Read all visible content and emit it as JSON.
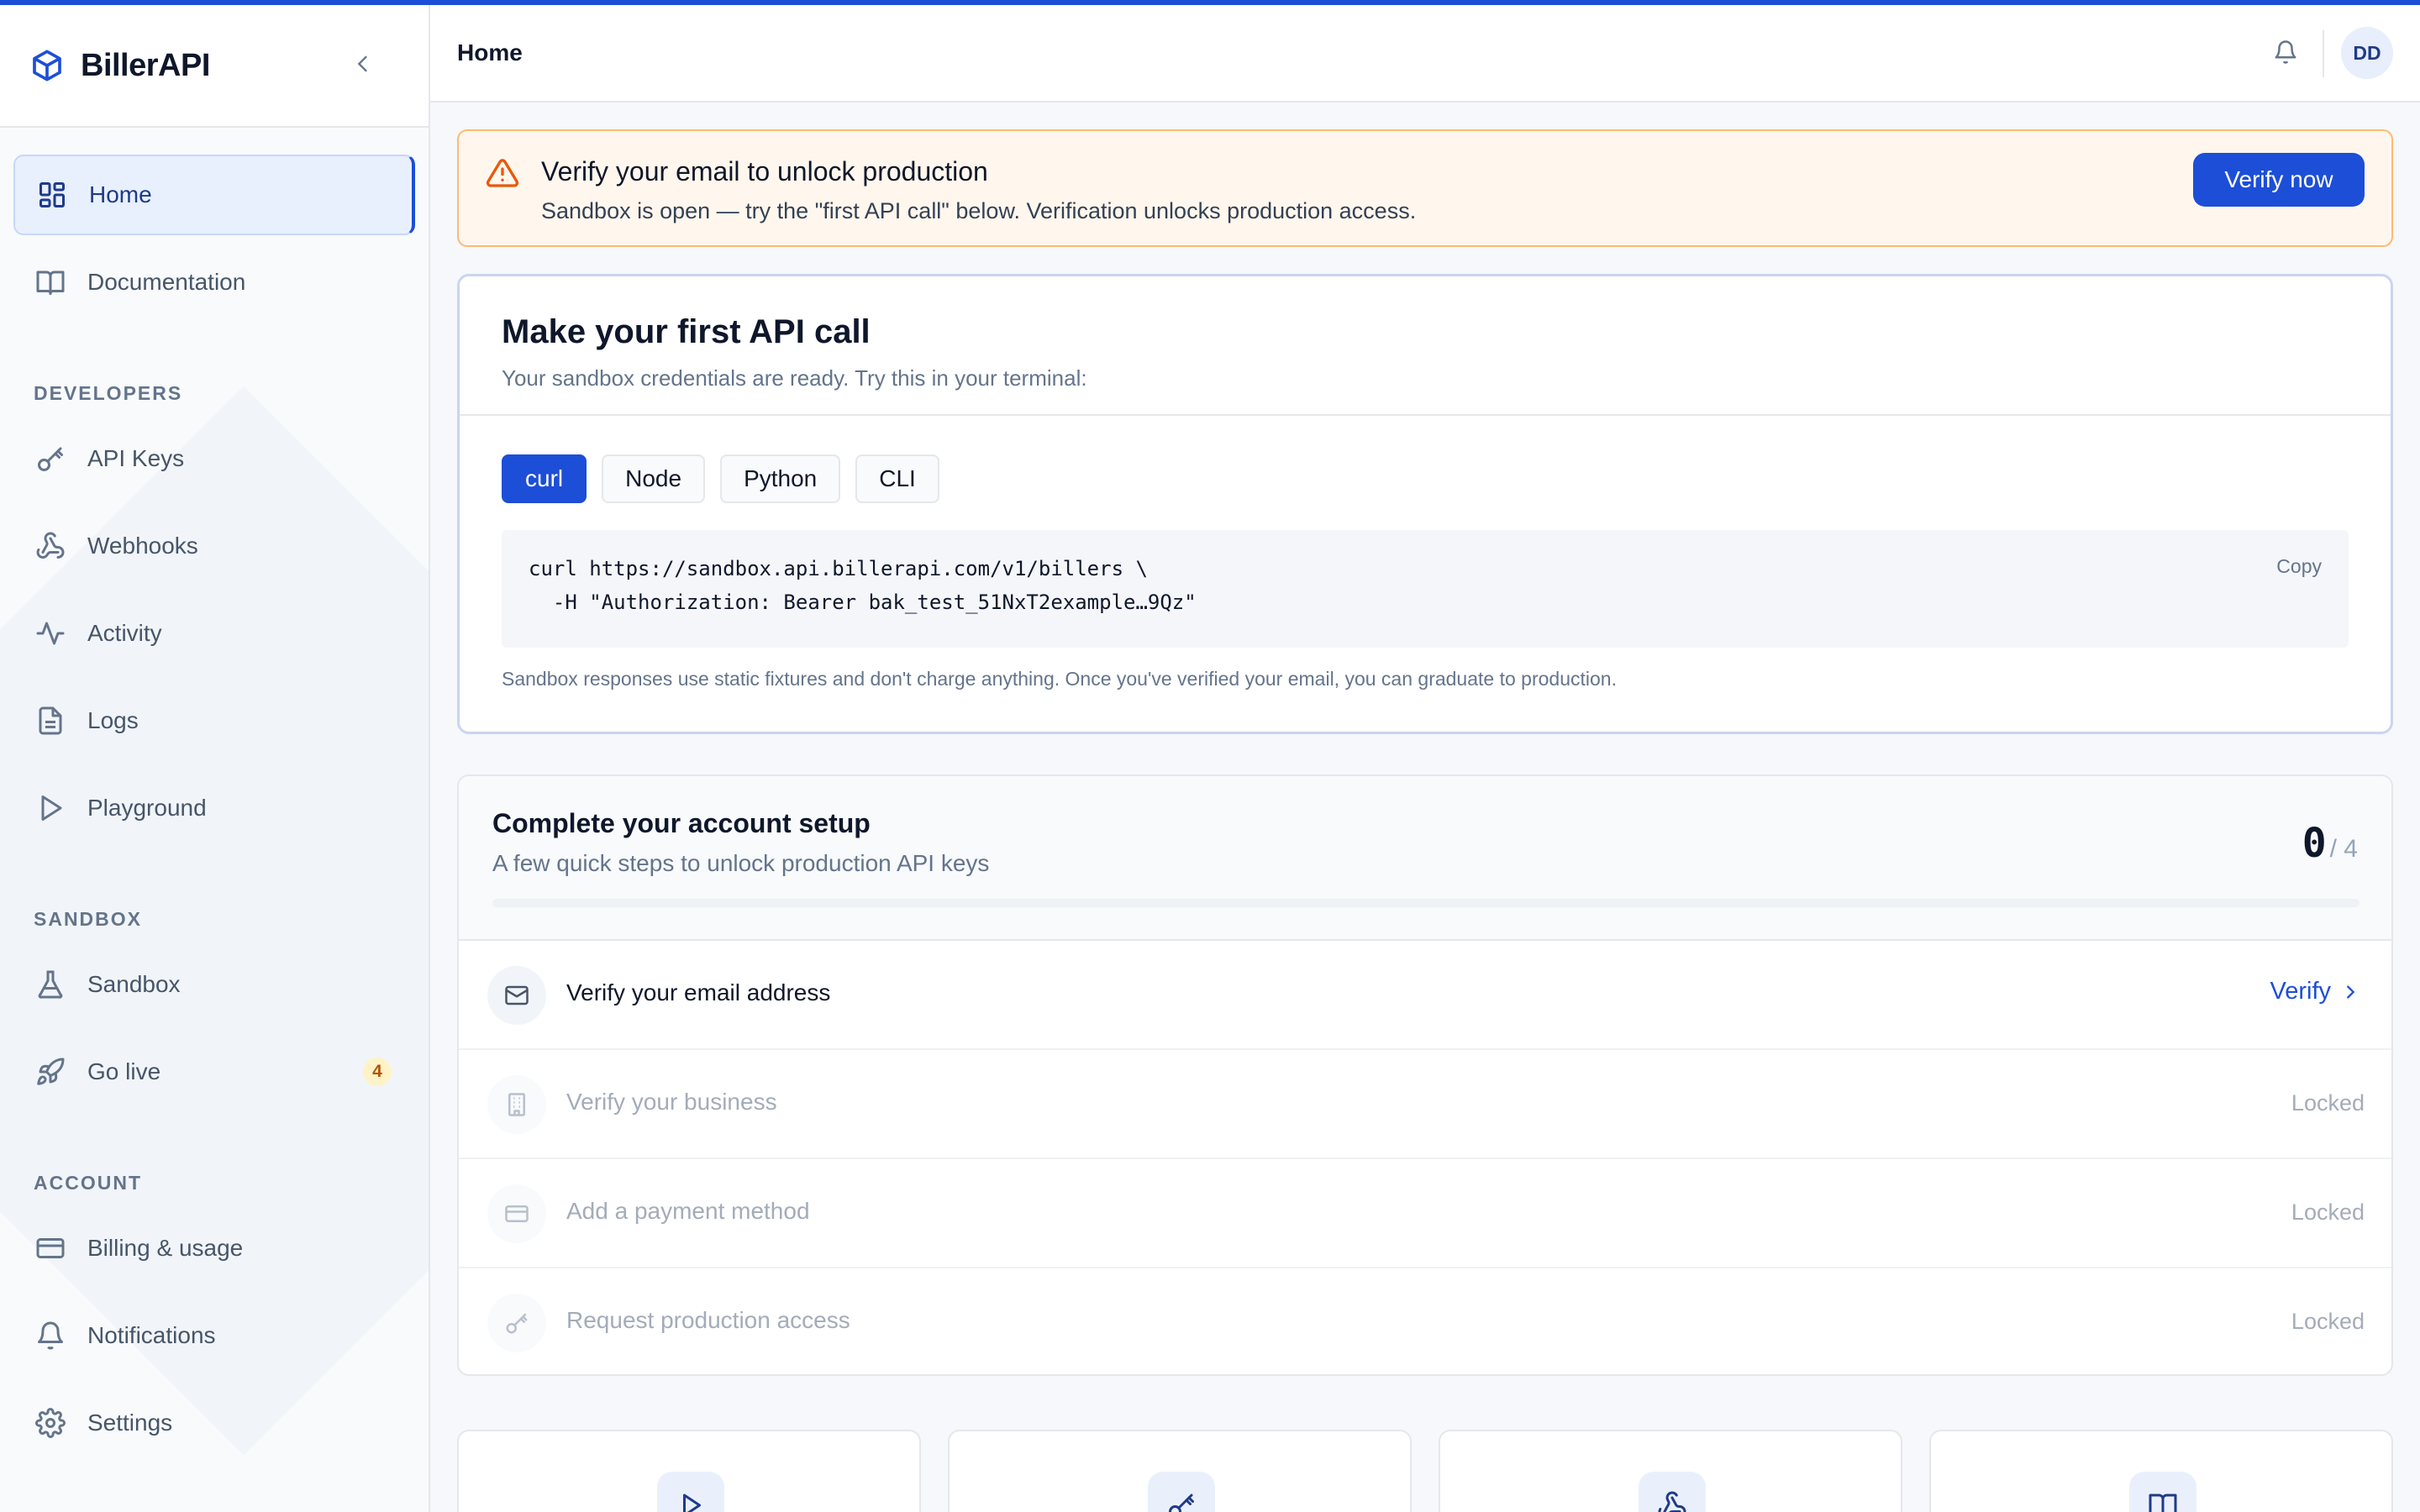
{
  "app": {
    "name": "BillerAPI"
  },
  "header": {
    "title": "Home",
    "avatar_initials": "DD"
  },
  "sidebar": {
    "items": [
      {
        "label": "Home",
        "icon": "grid-icon"
      },
      {
        "label": "Documentation",
        "icon": "book-icon"
      }
    ],
    "sections": [
      {
        "title": "DEVELOPERS",
        "items": [
          {
            "label": "API Keys",
            "icon": "key-icon"
          },
          {
            "label": "Webhooks",
            "icon": "webhook-icon"
          },
          {
            "label": "Activity",
            "icon": "activity-icon"
          },
          {
            "label": "Logs",
            "icon": "file-icon"
          },
          {
            "label": "Playground",
            "icon": "play-icon"
          }
        ]
      },
      {
        "title": "SANDBOX",
        "items": [
          {
            "label": "Sandbox",
            "icon": "flask-icon"
          },
          {
            "label": "Go live",
            "icon": "rocket-icon",
            "badge": "4"
          }
        ]
      },
      {
        "title": "ACCOUNT",
        "items": [
          {
            "label": "Billing & usage",
            "icon": "credit-card-icon"
          },
          {
            "label": "Notifications",
            "icon": "bell-icon"
          },
          {
            "label": "Settings",
            "icon": "gear-icon"
          }
        ]
      }
    ]
  },
  "alert": {
    "title": "Verify your email to unlock production",
    "text": "Sandbox is open — try the \"first API call\" below. Verification unlocks production access.",
    "button": "Verify now"
  },
  "api_card": {
    "title": "Make your first API call",
    "subtitle": "Your sandbox credentials are ready. Try this in your terminal:",
    "tabs": [
      "curl",
      "Node",
      "Python",
      "CLI"
    ],
    "active_tab": "curl",
    "code_line_1": "curl https://sandbox.api.billerapi.com/v1/billers \\",
    "code_line_2": "  -H \"Authorization: Bearer bak_test_51NxT2example…9Qz\"",
    "copy_label": "Copy",
    "note": "Sandbox responses use static fixtures and don't charge anything. Once you've verified your email, you can graduate to production."
  },
  "setup": {
    "title": "Complete your account setup",
    "subtitle": "A few quick steps to unlock production API keys",
    "completed": "0",
    "total": "/ 4",
    "progress": 0,
    "steps": [
      {
        "label": "Verify your email address",
        "action": "Verify",
        "icon": "mail-icon",
        "locked": false
      },
      {
        "label": "Verify your business",
        "status": "Locked",
        "icon": "building-icon",
        "locked": true
      },
      {
        "label": "Add a payment method",
        "status": "Locked",
        "icon": "credit-card-icon",
        "locked": true
      },
      {
        "label": "Request production access",
        "status": "Locked",
        "icon": "key-icon",
        "locked": true
      }
    ]
  },
  "tiles": [
    {
      "icon": "play-icon"
    },
    {
      "icon": "key-icon"
    },
    {
      "icon": "webhook-icon"
    },
    {
      "icon": "book-icon"
    }
  ],
  "colors": {
    "accent": "#1d4ed8",
    "alert_bg": "#fff7ed",
    "alert_border": "#fdba74",
    "warning_icon": "#ea580c",
    "badge_bg": "#fef3c7"
  }
}
